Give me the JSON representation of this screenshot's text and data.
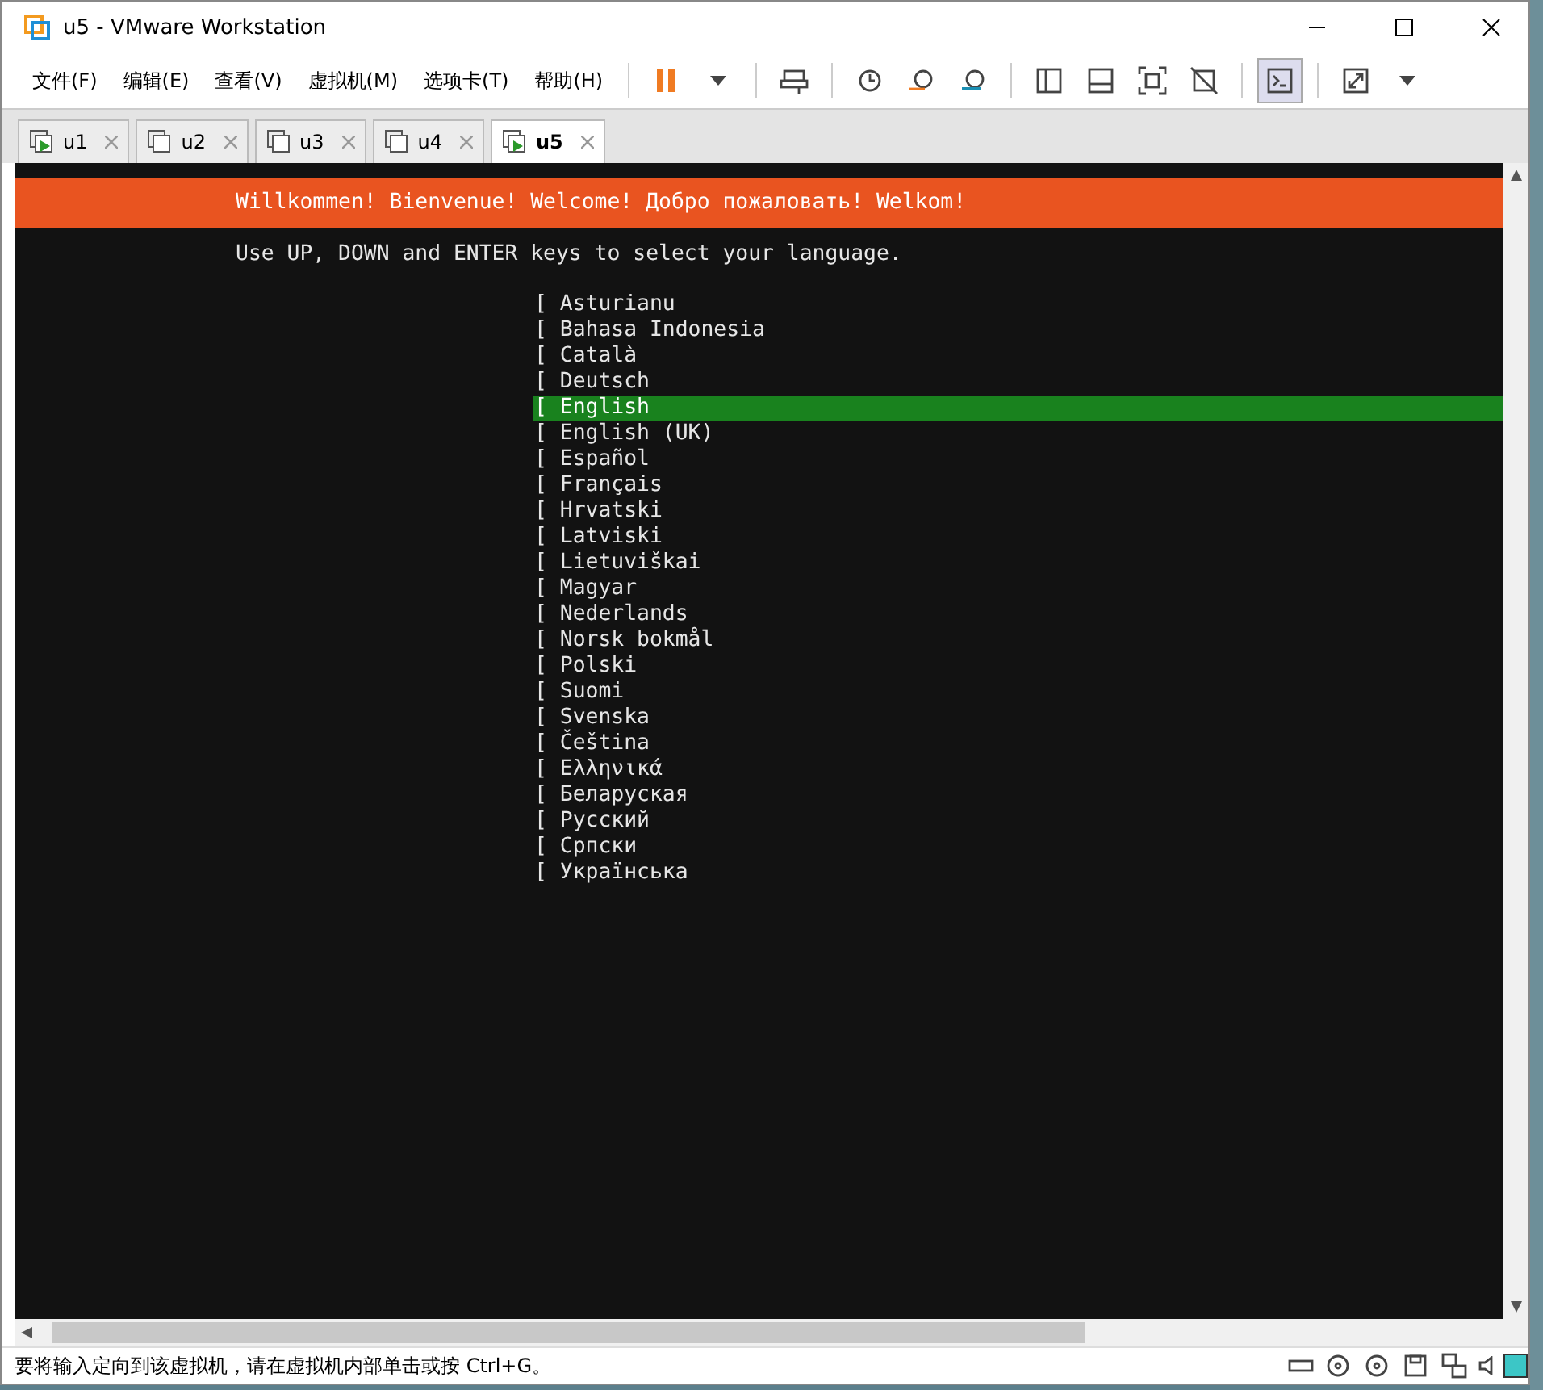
{
  "window": {
    "title": "u5 - VMware Workstation"
  },
  "menu": [
    "文件(F)",
    "编辑(E)",
    "查看(V)",
    "虚拟机(M)",
    "选项卡(T)",
    "帮助(H)"
  ],
  "tabs": [
    {
      "label": "u1",
      "selected": false,
      "running": true
    },
    {
      "label": "u2",
      "selected": false,
      "running": false
    },
    {
      "label": "u3",
      "selected": false,
      "running": false
    },
    {
      "label": "u4",
      "selected": false,
      "running": false
    },
    {
      "label": "u5",
      "selected": true,
      "running": true
    }
  ],
  "console": {
    "banner": "Willkommen! Bienvenue! Welcome! Добро пожаловать! Welkom!",
    "instruction": "Use UP, DOWN and ENTER keys to select your language.",
    "languages": [
      {
        "label": "[ Asturianu",
        "selected": false
      },
      {
        "label": "[ Bahasa Indonesia",
        "selected": false
      },
      {
        "label": "[ Català",
        "selected": false
      },
      {
        "label": "[ Deutsch",
        "selected": false
      },
      {
        "label": "[ English",
        "selected": true
      },
      {
        "label": "[ English (UK)",
        "selected": false
      },
      {
        "label": "[ Español",
        "selected": false
      },
      {
        "label": "[ Français",
        "selected": false
      },
      {
        "label": "[ Hrvatski",
        "selected": false
      },
      {
        "label": "[ Latviski",
        "selected": false
      },
      {
        "label": "[ Lietuviškai",
        "selected": false
      },
      {
        "label": "[ Magyar",
        "selected": false
      },
      {
        "label": "[ Nederlands",
        "selected": false
      },
      {
        "label": "[ Norsk bokmål",
        "selected": false
      },
      {
        "label": "[ Polski",
        "selected": false
      },
      {
        "label": "[ Suomi",
        "selected": false
      },
      {
        "label": "[ Svenska",
        "selected": false
      },
      {
        "label": "[ Čeština",
        "selected": false
      },
      {
        "label": "[ Ελληνικά",
        "selected": false
      },
      {
        "label": "[ Беларуская",
        "selected": false
      },
      {
        "label": "[ Русский",
        "selected": false
      },
      {
        "label": "[ Српски",
        "selected": false
      },
      {
        "label": "[ Українська",
        "selected": false
      }
    ]
  },
  "status_bar": {
    "message": "要将输入定向到该虚拟机，请在虚拟机内部单击或按 Ctrl+G。"
  }
}
